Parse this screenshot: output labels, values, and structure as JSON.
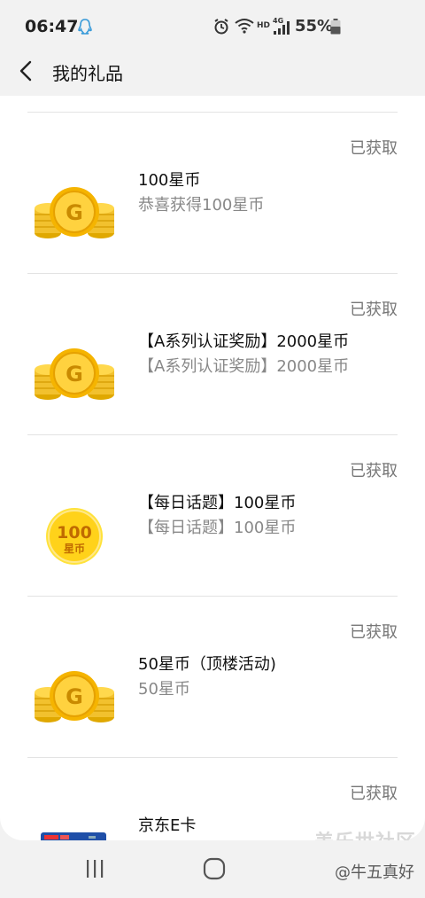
{
  "status_bar": {
    "time": "06:47",
    "battery_percent": "55%",
    "icons": [
      "qq-icon",
      "alarm-icon",
      "wifi-icon",
      "hd-icon",
      "4g-signal-icon",
      "battery-icon"
    ],
    "hd_label": "HD",
    "network_label": "4G"
  },
  "header": {
    "title": "我的礼品"
  },
  "gifts": [
    {
      "status": "已获取",
      "title": "100星币",
      "desc": "恭喜获得100星币",
      "image": "gold-coins-icon"
    },
    {
      "status": "已获取",
      "title": "【A系列认证奖励】2000星币",
      "desc": "【A系列认证奖励】2000星币",
      "image": "gold-coins-icon"
    },
    {
      "status": "已获取",
      "title": "【每日话题】100星币",
      "desc": "【每日话题】100星币",
      "image": "100-coin-icon",
      "coin_number": "100",
      "coin_label": "星币"
    },
    {
      "status": "已获取",
      "title": "50星币（顶楼活动)",
      "desc": "50星币",
      "image": "gold-coins-icon"
    },
    {
      "status": "已获取",
      "title": "京东E卡",
      "desc": "",
      "image": "jd-card-icon"
    }
  ],
  "watermark": {
    "site": "盖乐世社区",
    "author": "@牛五真好"
  },
  "colors": {
    "background": "#f2f2f2",
    "card": "#ffffff",
    "coin": "#f5c518",
    "status_text": "#777777"
  }
}
